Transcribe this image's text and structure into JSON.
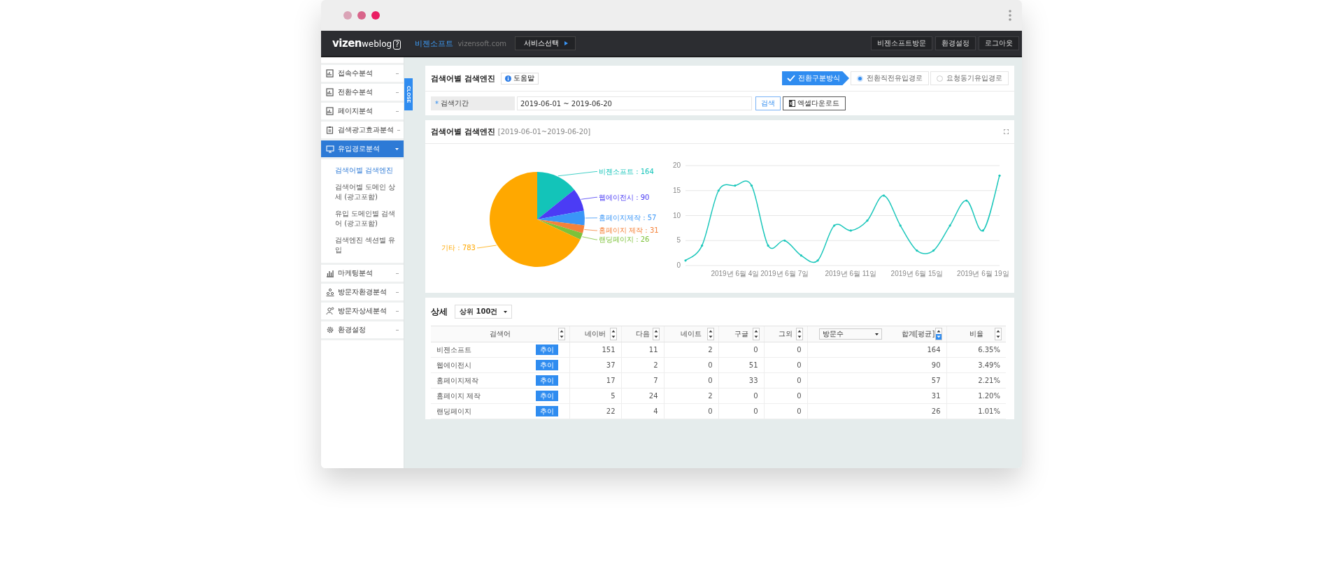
{
  "header": {
    "logo": {
      "word1": "vizen",
      "word2": "weblog",
      "mark": "?"
    },
    "site_name": "비젠소프트",
    "site_domain": "vizensoft.com",
    "service_button": "서비스선택",
    "right_buttons": [
      "비젠소프트방문",
      "환경설정",
      "로그아웃"
    ]
  },
  "sidebar": {
    "close_tab": "CLOSE",
    "items": [
      {
        "label": "접속수분석",
        "selected": false,
        "expanded": false
      },
      {
        "label": "전환수분석",
        "selected": false,
        "expanded": false
      },
      {
        "label": "페이지분석",
        "selected": false,
        "expanded": false
      },
      {
        "label": "검색광고효과분석",
        "selected": false,
        "expanded": false
      },
      {
        "label": "유입경로분석",
        "selected": true,
        "expanded": true,
        "children": [
          {
            "label": "검색어별 검색엔진",
            "selected": true
          },
          {
            "label": "검색어별 도메인 상세 (광고포함)",
            "selected": false
          },
          {
            "label": "유입 도메인별 검색어 (광고포함)",
            "selected": false
          },
          {
            "label": "검색엔진 섹션별 유입",
            "selected": false
          }
        ]
      },
      {
        "label": "마케팅분석",
        "selected": false,
        "expanded": false
      },
      {
        "label": "방문자환경분석",
        "selected": false,
        "expanded": false
      },
      {
        "label": "방문자상세분석",
        "selected": false,
        "expanded": false
      },
      {
        "label": "환경설정",
        "selected": false,
        "expanded": false
      }
    ]
  },
  "top_panel": {
    "title": "검색어별 검색엔진",
    "help_button": "도움말",
    "mode_label": "전환구분방식",
    "mode_options": [
      {
        "label": "전환직전유입경로",
        "selected": true
      },
      {
        "label": "요청동기유입경로",
        "selected": false
      }
    ],
    "search": {
      "required_mark": "*",
      "label": "검색기간",
      "value": "2019-06-01 ~ 2019-06-20",
      "search_button": "검색",
      "excel_button": "엑셀다운로드"
    }
  },
  "chart_panel": {
    "title": "검색어별 검색엔진",
    "period": "[2019-06-01~2019-06-20]",
    "pie": {
      "chart_data": {
        "type": "pie",
        "values": [
          164,
          90,
          57,
          31,
          26,
          783
        ],
        "colors": [
          "#13c4b9",
          "#4b3cf5",
          "#3a96f7",
          "#f5823a",
          "#7dc23a",
          "#ffa800"
        ],
        "value_labels": [
          "비젠소프트 : 164",
          "웹에이전시 : 90",
          "홈페이지제작 : 57",
          "홈페이지 제작 : 31",
          "랜딩페이지 : 26",
          "기타 : 783"
        ]
      }
    },
    "line": {
      "chart_data": {
        "type": "line",
        "categories": [
          null,
          null,
          null,
          "2019년 6월 4일",
          null,
          null,
          "2019년 6월 7일",
          null,
          null,
          null,
          "2019년 6월 11일",
          null,
          null,
          null,
          "2019년 6월 15일",
          null,
          null,
          null,
          "2019년 6월 19일",
          null
        ],
        "series": [
          {
            "color": "#1cc7bb",
            "values": [
              1,
              4,
              15,
              16,
              16,
              4,
              5,
              2,
              1,
              8,
              7,
              9,
              14,
              8,
              3,
              3,
              8,
              13,
              7,
              18
            ]
          }
        ],
        "ylim": [
          0,
          20
        ],
        "yticks": [
          0,
          5,
          10,
          15,
          20
        ],
        "grid": true
      }
    }
  },
  "detail_panel": {
    "title": "상세",
    "limit_select": "상위 100건",
    "columns": [
      {
        "label": "검색어",
        "sort_desc": false
      },
      {
        "label": "네이버",
        "sort_desc": false
      },
      {
        "label": "다음",
        "sort_desc": false
      },
      {
        "label": "네이트",
        "sort_desc": false
      },
      {
        "label": "구글",
        "sort_desc": false
      },
      {
        "label": "그외",
        "sort_desc": false
      },
      {
        "label": "합계[평균]",
        "select": "방문수",
        "sort_desc": true
      },
      {
        "label": "비율",
        "sort_desc": false
      }
    ],
    "rows": [
      {
        "trend_button": "추이",
        "cells": [
          "비젠소프트",
          "151",
          "11",
          "2",
          "0",
          "0",
          "164",
          "6.35%"
        ]
      },
      {
        "trend_button": "추이",
        "cells": [
          "웹에이전시",
          "37",
          "2",
          "0",
          "51",
          "0",
          "90",
          "3.49%"
        ]
      },
      {
        "trend_button": "추이",
        "cells": [
          "홈페이지제작",
          "17",
          "7",
          "0",
          "33",
          "0",
          "57",
          "2.21%"
        ]
      },
      {
        "trend_button": "추이",
        "cells": [
          "홈페이지 제작",
          "5",
          "24",
          "2",
          "0",
          "0",
          "31",
          "1.20%"
        ]
      },
      {
        "trend_button": "추이",
        "cells": [
          "랜딩페이지",
          "22",
          "4",
          "0",
          "0",
          "0",
          "26",
          "1.01%"
        ]
      }
    ]
  }
}
